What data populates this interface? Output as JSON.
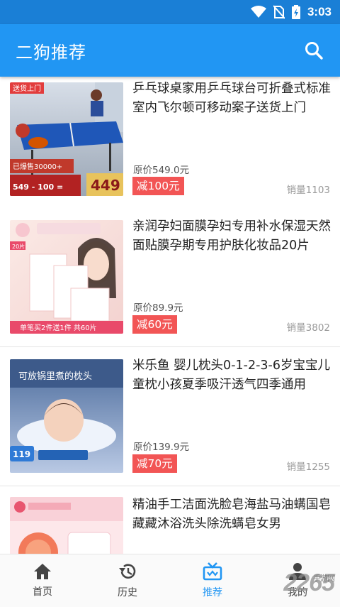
{
  "status_bar": {
    "time": "3:03"
  },
  "app_bar": {
    "title": "二狗推荐"
  },
  "products": [
    {
      "name": "乒乓球桌家用乒乓球台可折叠式标准室内飞尔顿可移动案子送货上门",
      "original_price": "原价549.0元",
      "discount": "减100元",
      "sales": "销量1103",
      "image": {
        "tag": "送货上门",
        "badge": "已爆售30000+",
        "price": "549 - 100 =",
        "final": "449"
      }
    },
    {
      "name": "亲润孕妇面膜孕妇专用补水保湿天然面贴膜孕期专用护肤化妆品20片",
      "original_price": "原价89.9元",
      "discount": "减60元",
      "sales": "销量3802",
      "image": {
        "tag": "20片",
        "banner": "单笔买2件送1件  共60片"
      }
    },
    {
      "name": "米乐鱼 婴儿枕头0-1-2-3-6岁宝宝儿童枕小孩夏季吸汗透气四季通用",
      "original_price": "原价139.9元",
      "discount": "减70元",
      "sales": "销量1255",
      "image": {
        "headline": "可放锅里煮的枕头",
        "price": "119"
      }
    },
    {
      "name": "精油手工洁面洗脸皂海盐马油螨国皂藏藏沐浴洗头除洗螨皂女男",
      "original_price": "",
      "discount": "",
      "sales": "",
      "image": {}
    }
  ],
  "tabs": [
    {
      "label": "首页",
      "icon": "home-icon"
    },
    {
      "label": "历史",
      "icon": "history-icon"
    },
    {
      "label": "推荐",
      "icon": "recommend-icon",
      "active": true
    },
    {
      "label": "我的",
      "icon": "profile-icon"
    }
  ],
  "watermark": {
    "text": "2265",
    "sub": "手游网"
  },
  "colors": {
    "primary": "#2196f3",
    "status_bar": "#1a7fd6",
    "discount": "#f25555",
    "active_tab": "#2196f3"
  }
}
